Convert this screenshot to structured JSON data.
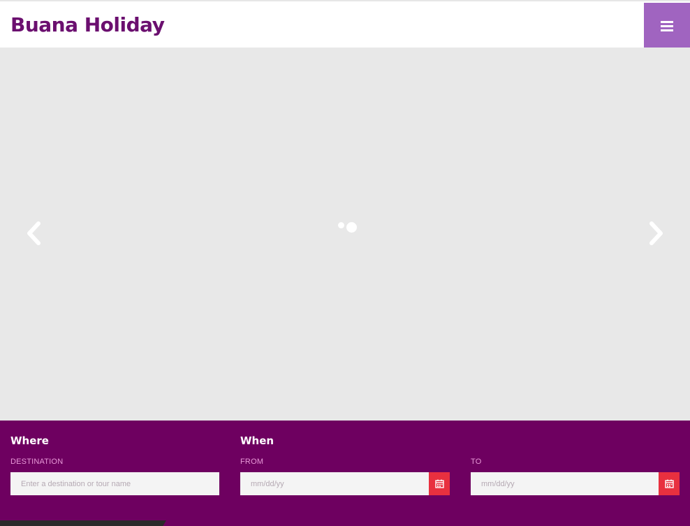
{
  "header": {
    "logo_text": "Buana Holiday",
    "menu_icon": "hamburger-icon"
  },
  "slider": {
    "prev_icon": "chevron-left-icon",
    "next_icon": "chevron-right-icon",
    "loader_icon": "loading-dots-icon"
  },
  "search": {
    "where_title": "Where",
    "when_title": "When",
    "destination_label": "DESTINATION",
    "destination_placeholder": "Enter a destination or tour name",
    "from_label": "FROM",
    "from_placeholder": "mm/dd/yy",
    "to_label": "TO",
    "to_placeholder": "mm/dd/yy",
    "calendar_icon": "calendar-icon"
  },
  "colors": {
    "brand_purple": "#6e0060",
    "menu_button": "#a064c0",
    "calendar_button": "#e8303f",
    "label_pink": "#e89ad8",
    "slider_bg": "#e8e8e8"
  }
}
